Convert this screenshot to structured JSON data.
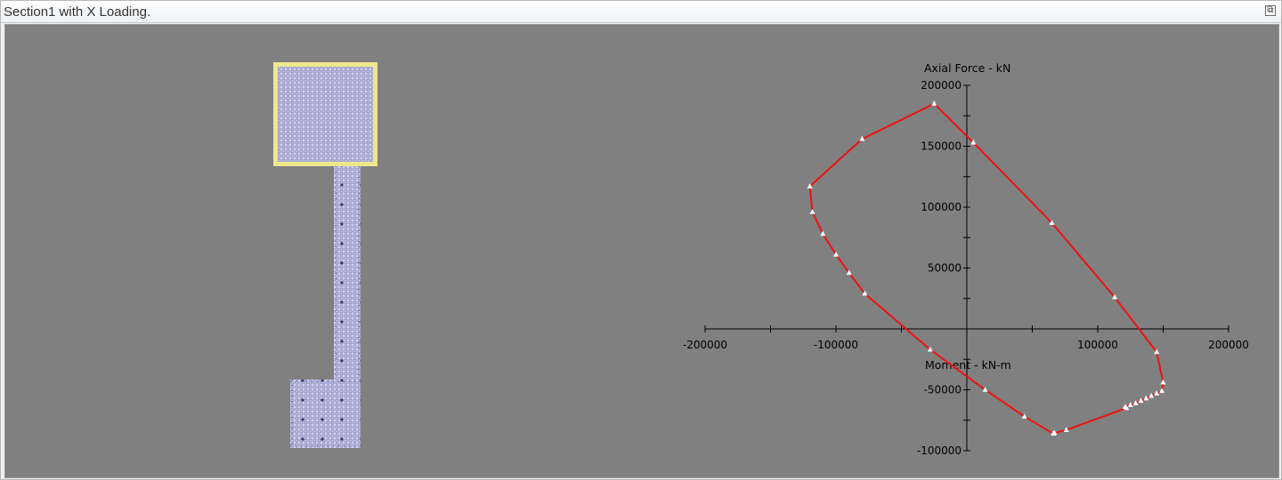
{
  "window": {
    "title": "Section1 with X Loading.",
    "close_icon": "restore-icon"
  },
  "colors": {
    "canvas_bg": "#808080",
    "section_fill": "#ccccee",
    "section_mesh": "#7777aa",
    "section_highlight": "#f0e68c",
    "curve": "#ee1111",
    "marker": "#ffffff"
  },
  "chart_data": {
    "type": "line",
    "xlabel": "Moment - kN-m",
    "ylabel": "Axial Force - kN",
    "xlim": [
      -200000,
      200000
    ],
    "ylim": [
      -100000,
      200000
    ],
    "x_ticks": [
      -200000,
      -150000,
      -100000,
      -50000,
      0,
      50000,
      100000,
      150000,
      200000
    ],
    "x_tick_labels": [
      "-200000",
      "-100000",
      "100000",
      "200000"
    ],
    "x_tick_label_values": [
      -200000,
      -100000,
      100000,
      200000
    ],
    "y_ticks": [
      -100000,
      -75000,
      -50000,
      -25000,
      0,
      25000,
      50000,
      75000,
      100000,
      125000,
      150000,
      175000,
      200000
    ],
    "y_tick_labels": [
      "200000",
      "150000",
      "100000",
      "50000",
      "-50000",
      "-100000"
    ],
    "y_tick_label_values": [
      200000,
      150000,
      100000,
      50000,
      -50000,
      -100000
    ],
    "series": [
      {
        "closed": true,
        "points": [
          [
            -25000,
            185000
          ],
          [
            5000,
            153000
          ],
          [
            65000,
            87000
          ],
          [
            113000,
            26000
          ],
          [
            145000,
            -19000
          ],
          [
            150000,
            -44000
          ],
          [
            149000,
            -51000
          ],
          [
            145000,
            -53000
          ],
          [
            141000,
            -55000
          ],
          [
            137000,
            -57000
          ],
          [
            133000,
            -59000
          ],
          [
            129000,
            -61000
          ],
          [
            125000,
            -62500
          ],
          [
            121000,
            -64000
          ],
          [
            122000,
            -65000
          ],
          [
            76000,
            -83000
          ],
          [
            67000,
            -85500
          ],
          [
            66000,
            -86000
          ],
          [
            44000,
            -72000
          ],
          [
            14000,
            -50000
          ],
          [
            -28000,
            -17000
          ],
          [
            -78000,
            29000
          ],
          [
            -90000,
            46000
          ],
          [
            -100000,
            61000
          ],
          [
            -110000,
            78000
          ],
          [
            -118000,
            96000
          ],
          [
            -120000,
            117000
          ],
          [
            -80000,
            156000
          ],
          [
            -25000,
            185000
          ]
        ]
      }
    ]
  }
}
